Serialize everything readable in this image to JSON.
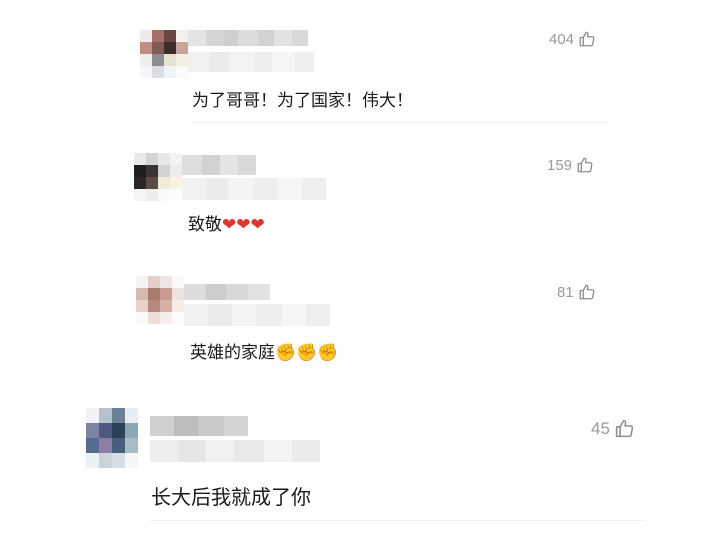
{
  "comments": [
    {
      "likes": "404",
      "text": "为了哥哥！为了国家！伟大！"
    },
    {
      "likes": "159",
      "text": "致敬",
      "emoji": [
        "❤",
        "❤",
        "❤"
      ]
    },
    {
      "likes": "81",
      "text": "英雄的家庭",
      "emoji": [
        "✊",
        "✊",
        "✊"
      ]
    },
    {
      "likes": "45",
      "text": "长大后我就成了你"
    }
  ],
  "icons": {
    "like": "thumbs-up-icon",
    "heart": "heart-icon",
    "fist": "fist-icon"
  },
  "colors": {
    "likes_text": "#9a9a9a",
    "heart": "#e0352b",
    "text": "#1a1a1a"
  }
}
